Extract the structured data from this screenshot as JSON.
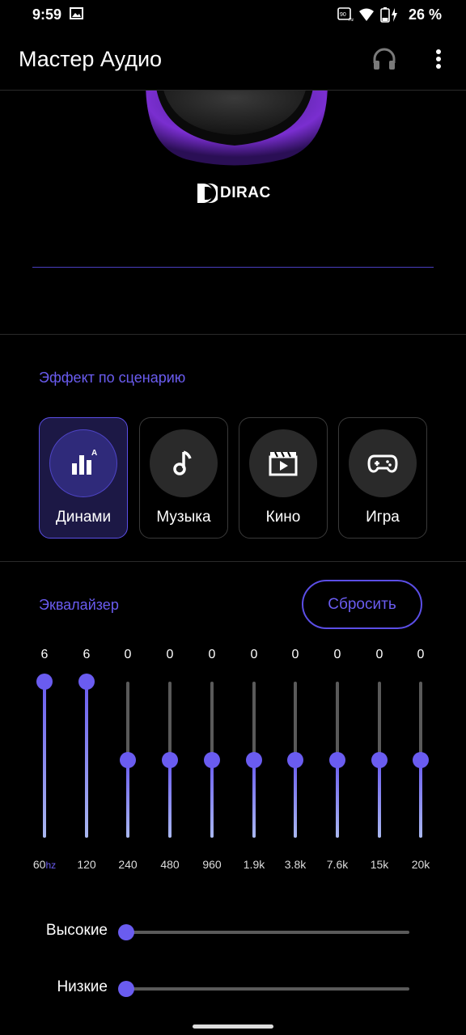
{
  "status_bar": {
    "time": "9:59",
    "battery_text": "26 %",
    "icons": [
      "image-icon",
      "hd-icon",
      "wifi-icon",
      "battery-charging-icon"
    ]
  },
  "app_bar": {
    "title": "Мастер Аудио",
    "icons": [
      "headphones-icon",
      "more-vert-icon"
    ]
  },
  "knob": {
    "brand": "DIRAC"
  },
  "scenario": {
    "label": "Эффект по сценарию",
    "cards": [
      {
        "label": "Динами",
        "icon": "dynamic-bars-icon",
        "active": true
      },
      {
        "label": "Музыка",
        "icon": "music-note-icon",
        "active": false
      },
      {
        "label": "Кино",
        "icon": "movie-icon",
        "active": false
      },
      {
        "label": "Игра",
        "icon": "gamepad-icon",
        "active": false
      }
    ]
  },
  "equalizer": {
    "label": "Эквалайзер",
    "reset_label": "Сбросить",
    "range": [
      -6,
      6
    ],
    "unit": "hz",
    "bands": [
      {
        "freq": "60",
        "value": "6"
      },
      {
        "freq": "120",
        "value": "6"
      },
      {
        "freq": "240",
        "value": "0"
      },
      {
        "freq": "480",
        "value": "0"
      },
      {
        "freq": "960",
        "value": "0"
      },
      {
        "freq": "1.9k",
        "value": "0"
      },
      {
        "freq": "3.8k",
        "value": "0"
      },
      {
        "freq": "7.6k",
        "value": "0"
      },
      {
        "freq": "15k",
        "value": "0"
      },
      {
        "freq": "20k",
        "value": "0"
      }
    ]
  },
  "tone": {
    "treble_label": "Высокие",
    "treble_level": 0,
    "bass_label": "Низкие",
    "bass_level": 0
  },
  "colors": {
    "accent": "#6a5cf0",
    "background": "#000000",
    "card_active": "#1c1845"
  }
}
